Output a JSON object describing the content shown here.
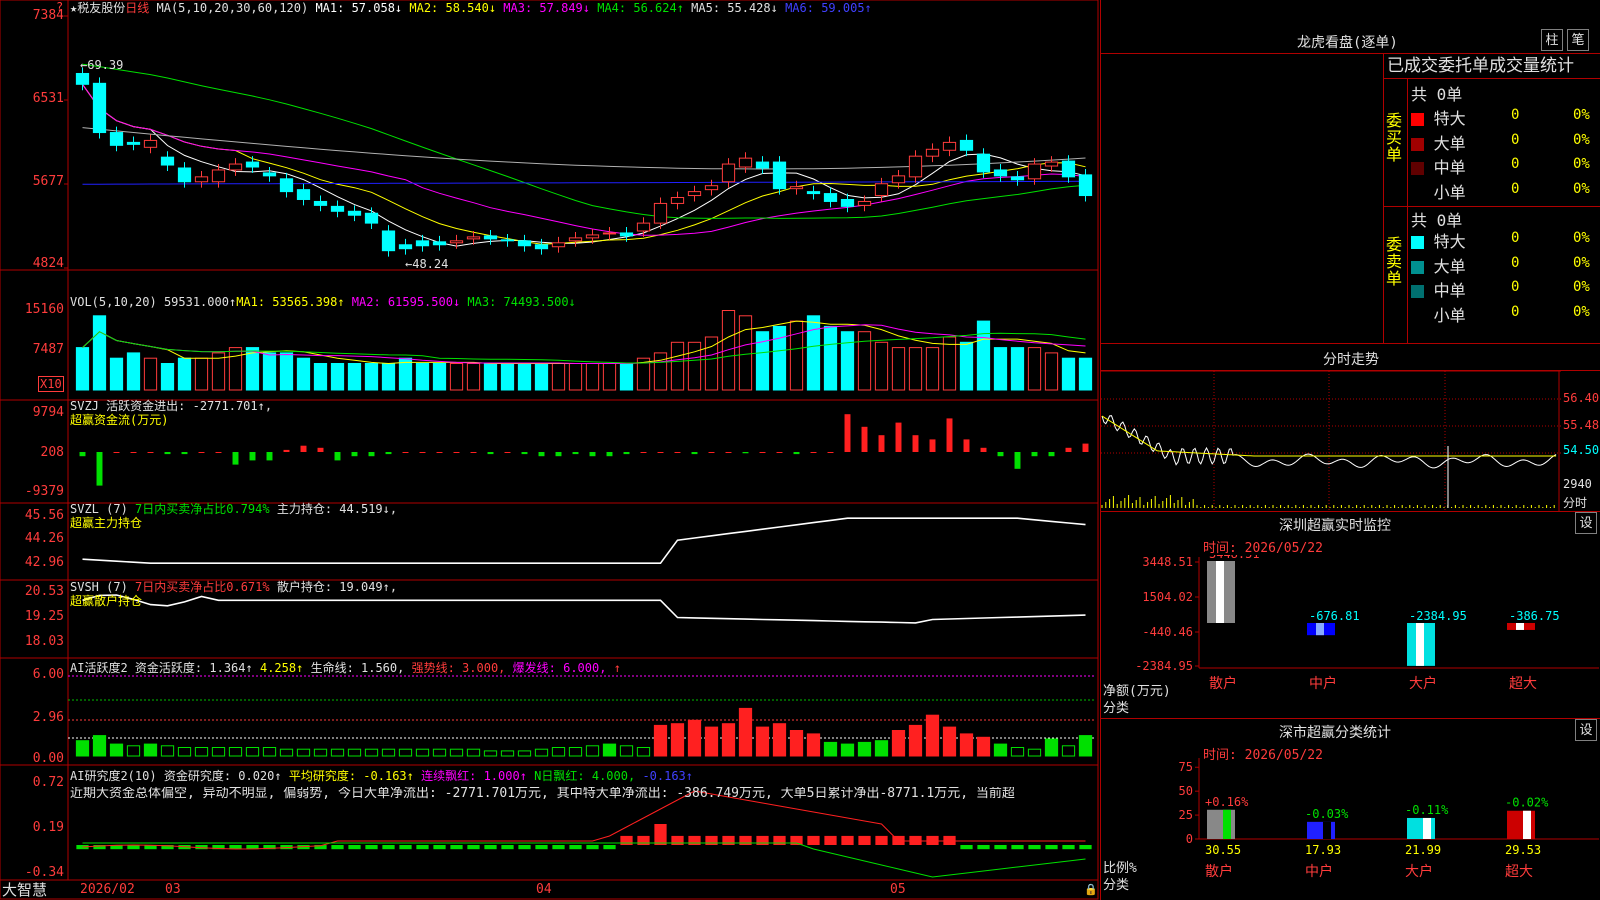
{
  "header": {
    "star": "★",
    "name": "税友股份",
    "period": "日线",
    "ma_spec": "MA(5,10,20,30,60,120)",
    "ma": [
      {
        "label": "MA1:",
        "value": "57.058↓",
        "color": "#ffffff"
      },
      {
        "label": "MA2:",
        "value": "58.540↓",
        "color": "#ffff00"
      },
      {
        "label": "MA3:",
        "value": "57.849↓",
        "color": "#ff00ff"
      },
      {
        "label": "MA4:",
        "value": "56.624↑",
        "color": "#00e000"
      },
      {
        "label": "MA5:",
        "value": "55.428↓",
        "color": "#e0e0e0"
      },
      {
        "label": "MA6:",
        "value": "59.005↑",
        "color": "#4040ff"
      }
    ],
    "question": "?"
  },
  "price_axis": [
    "7384",
    "6531",
    "5677",
    "4824"
  ],
  "price_annot": {
    "high": "69.39",
    "low": "48.24"
  },
  "vol": {
    "title": "VOL(5,10,20)",
    "v": "59531.000↑",
    "ma1": "MA1: 53565.398↑",
    "ma2": "MA2: 61595.500↓",
    "ma3": "MA3: 74493.500↓",
    "axis": [
      "15160",
      "7487"
    ],
    "unit": "X10"
  },
  "svzj": {
    "name": "SVZJ",
    "l1a": "活跃资金进出:",
    "l1b": "-2771.701↑,",
    "l2": "超赢资金流(万元)",
    "axis": [
      "9794",
      "208",
      "-9379"
    ]
  },
  "svzl": {
    "name": "SVZL (7)",
    "l1a": "7日内买卖净占比0.794%",
    "l1b": "主力持仓: 44.519↓,",
    "l2": "超赢主力持仓",
    "axis": [
      "45.56",
      "44.26",
      "42.96"
    ]
  },
  "svsh": {
    "name": "SVSH (7)",
    "l1a": "7日内买卖净占比0.671%",
    "l1b": "散户持仓: 19.049↑,",
    "l2": "超赢散户持仓",
    "axis": [
      "20.53",
      "19.25",
      "18.03"
    ]
  },
  "ai1": {
    "name": "AI活跃度2",
    "a": "资金活跃度: 1.364↑",
    "b": "4.258↑",
    "c": "生命线: 1.560,",
    "d": "强势线: 3.000,",
    "e": "爆发线: 6.000,",
    "f": "↑",
    "axis": [
      "6.00",
      "2.96",
      "0.00"
    ]
  },
  "ai2": {
    "name": "AI研究度2(10)",
    "a": "资金研究度: 0.020↑",
    "b": "平均研究度: -0.163↑",
    "c": "连续飘红: 1.000↑",
    "d": "N日飘红: 4.000,",
    "e": "-0.163↑",
    "summary": "近期大资金总体偏空, 异动不明显, 偏弱势, 今日大单净流出: -2771.701万元, 其中特大单净流出: -386.749万元, 大单5日累计净出-8771.1万元, 当前超",
    "axis": [
      "0.72",
      "0.19",
      "-0.34"
    ]
  },
  "date_axis": {
    "brand": "大智慧",
    "d1": "2026/02",
    "d2": "03",
    "d3": "04",
    "d4": "05"
  },
  "right": {
    "title": "龙虎看盘(逐单)",
    "btn1": "柱",
    "btn2": "笔",
    "section": "已成交委托单成交量统计",
    "buy": {
      "side": "委买单",
      "count": "共 0单",
      "rows": [
        {
          "label": "特大",
          "color": "#ff0000",
          "n": "0",
          "p": "0%"
        },
        {
          "label": "大单",
          "color": "#a00000",
          "n": "0",
          "p": "0%"
        },
        {
          "label": "中单",
          "color": "#600000",
          "n": "0",
          "p": "0%"
        },
        {
          "label": "小单",
          "color": "",
          "n": "0",
          "p": "0%"
        }
      ]
    },
    "sell": {
      "side": "委卖单",
      "count": "共 0单",
      "rows": [
        {
          "label": "特大",
          "color": "#00ffff",
          "n": "0",
          "p": "0%"
        },
        {
          "label": "大单",
          "color": "#009090",
          "n": "0",
          "p": "0%"
        },
        {
          "label": "中单",
          "color": "#007070",
          "n": "0",
          "p": "0%"
        },
        {
          "label": "小单",
          "color": "",
          "n": "0",
          "p": "0%"
        }
      ]
    },
    "intraday": {
      "title": "分时走势",
      "axis": [
        "56.40",
        "55.48",
        "54.50",
        "2940"
      ],
      "unit": "分时"
    },
    "monitor": {
      "title": "深圳超赢实时监控",
      "btn": "设",
      "time": "时间: 2026/05/22",
      "axis": [
        "3448.51",
        "1504.02",
        "-440.46",
        "-2384.95"
      ],
      "ylabel": "净额(万元)",
      "xlabel": "分类",
      "bars": [
        {
          "cat": "散户",
          "val": "3448.51",
          "v": 3448.51
        },
        {
          "cat": "中户",
          "val": "-676.81",
          "v": -676.81
        },
        {
          "cat": "大户",
          "val": "-2384.95",
          "v": -2384.95
        },
        {
          "cat": "超大",
          "val": "-386.75",
          "v": -386.75
        }
      ]
    },
    "classify": {
      "title": "深市超赢分类统计",
      "btn": "设",
      "time": "时间: 2026/05/22",
      "axis": [
        "75",
        "50",
        "25",
        "0"
      ],
      "ylabel": "比例%",
      "xlabel": "分类",
      "bars": [
        {
          "cat": "散户",
          "val": "30.55",
          "chg": "+0.16%",
          "v": 30.55
        },
        {
          "cat": "中户",
          "val": "17.93",
          "chg": "-0.03%",
          "v": 17.93
        },
        {
          "cat": "大户",
          "val": "21.99",
          "chg": "-0.11%",
          "v": 21.99
        },
        {
          "cat": "超大",
          "val": "29.53",
          "chg": "-0.02%",
          "v": 29.53
        }
      ]
    }
  }
}
